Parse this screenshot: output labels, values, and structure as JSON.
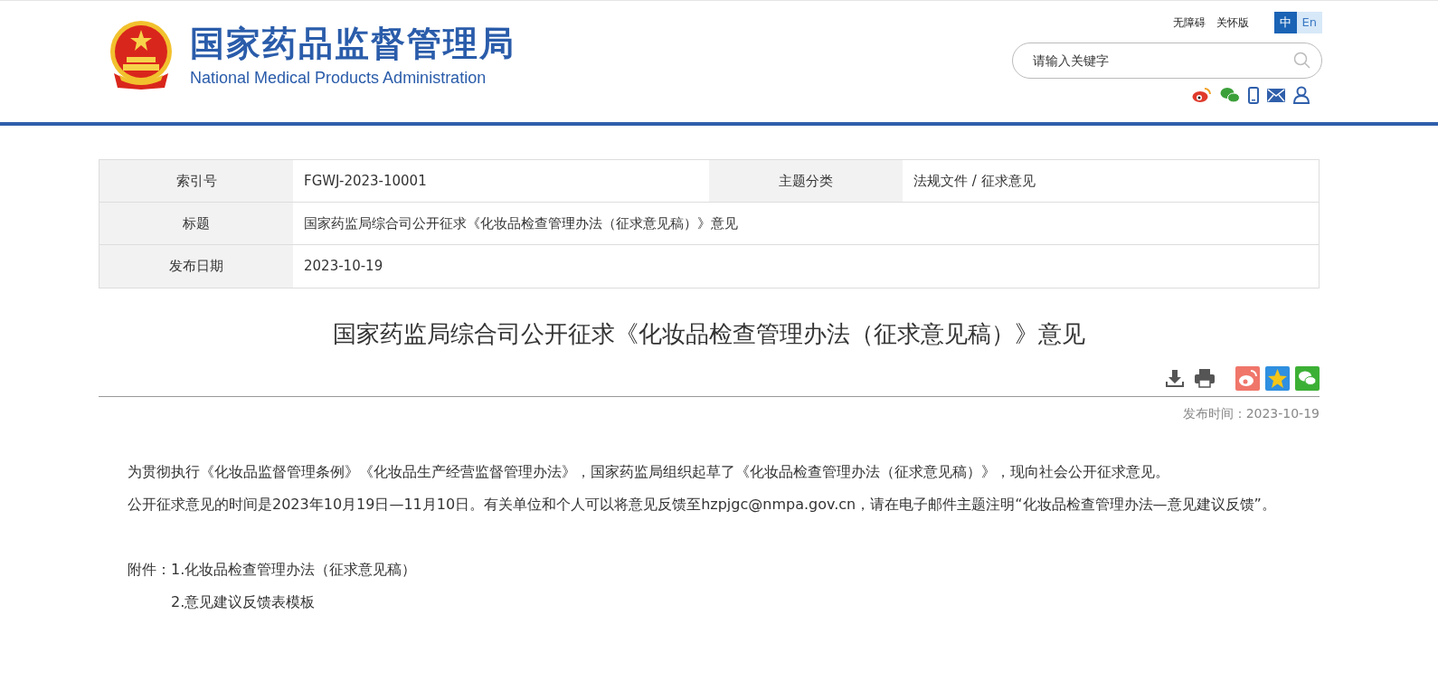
{
  "header": {
    "title": "国家药品监督管理局",
    "subtitle": "National Medical Products Administration",
    "top_links": [
      "无障碍",
      "关怀版"
    ],
    "languages": [
      {
        "label": "中",
        "selected": true
      },
      {
        "label": "En",
        "selected": false
      }
    ],
    "search": {
      "placeholder": "请输入关键字"
    }
  },
  "meta_table": {
    "rows": [
      {
        "fields": [
          {
            "label": "索引号",
            "value": "FGWJ-2023-10001"
          },
          {
            "label": "主题分类",
            "value": "法规文件 / 征求意见"
          }
        ]
      },
      {
        "fields": [
          {
            "label": "标题",
            "value": "国家药监局综合司公开征求《化妆品检查管理办法（征求意见稿）》意见"
          }
        ]
      },
      {
        "fields": [
          {
            "label": "发布日期",
            "value": "2023-10-19"
          }
        ]
      }
    ]
  },
  "article": {
    "title": "国家药监局综合司公开征求《化妆品检查管理办法（征求意见稿）》意见",
    "published": "发布时间：2023-10-19",
    "paragraphs": [
      "为贯彻执行《化妆品监督管理条例》《化妆品生产经营监督管理办法》，国家药监局组织起草了《化妆品检查管理办法（征求意见稿）》，现向社会公开征求意见。",
      "公开征求意见的时间是2023年10月19日—11月10日。有关单位和个人可以将意见反馈至hzpjgc@nmpa.gov.cn，请在电子邮件主题注明“化妆品检查管理办法—意见建议反馈”。"
    ],
    "attachments_label": "附件：",
    "attachments": [
      "1.化妆品检查管理办法（征求意见稿）",
      "2.意见建议反馈表模板"
    ]
  }
}
